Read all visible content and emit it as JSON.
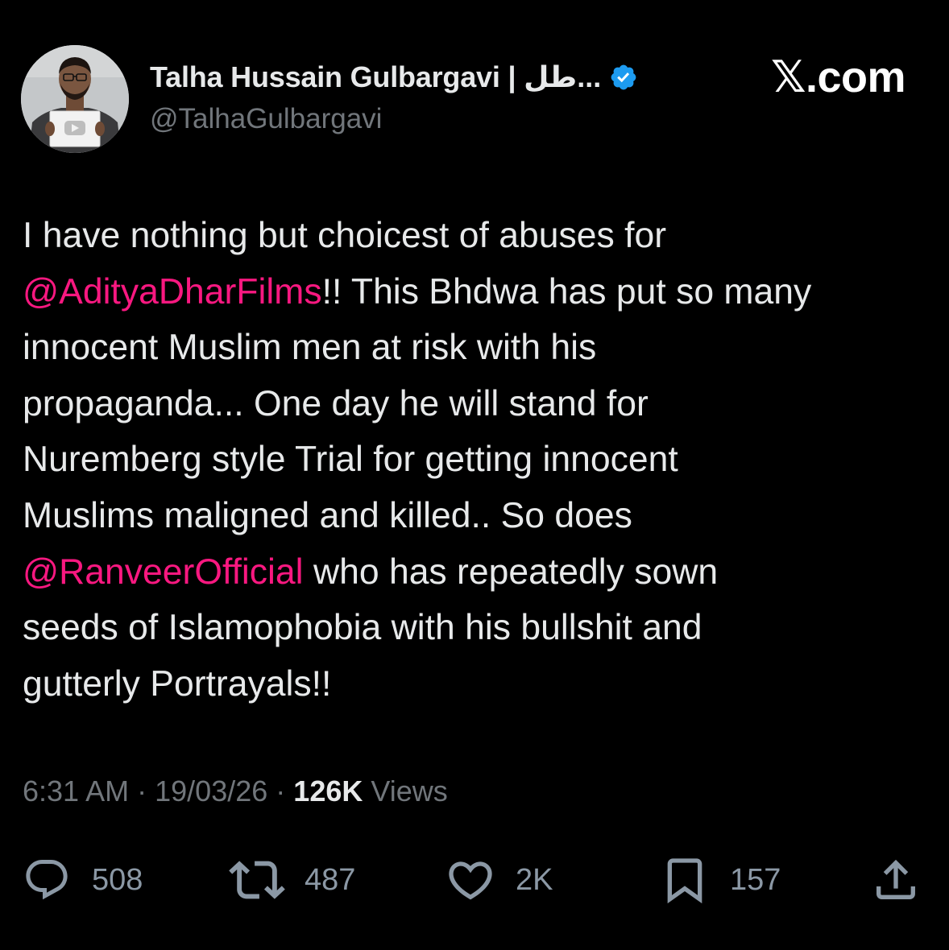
{
  "author": {
    "display_name": "Talha Hussain Gulbargavi | طل...",
    "handle": "@TalhaGulbargavi",
    "verified": true
  },
  "brand": "𝕏.com",
  "tweet": {
    "lines": [
      [
        {
          "text": "I have nothing but choicest of abuses for",
          "mention": false
        }
      ],
      [
        {
          "text": "@AdityaDharFilms",
          "mention": true
        },
        {
          "text": "!! This Bhdwa has put so many",
          "mention": false
        }
      ],
      [
        {
          "text": "innocent Muslim men at risk with his",
          "mention": false
        }
      ],
      [
        {
          "text": "propaganda... One day he will stand for",
          "mention": false
        }
      ],
      [
        {
          "text": "Nuremberg style Trial for getting innocent",
          "mention": false
        }
      ],
      [
        {
          "text": "Muslims maligned and killed.. So does",
          "mention": false
        }
      ],
      [
        {
          "text": "@RanveerOfficial",
          "mention": true
        },
        {
          "text": " who has repeatedly sown",
          "mention": false
        }
      ],
      [
        {
          "text": "seeds of Islamophobia with his bullshit and",
          "mention": false
        }
      ],
      [
        {
          "text": "gutterly Portrayals!!",
          "mention": false
        }
      ]
    ]
  },
  "meta": {
    "time": "6:31 AM",
    "separator": "·",
    "date": "19/03/26",
    "views_count": "126K",
    "views_label": "Views"
  },
  "actions": {
    "replies": "508",
    "reposts": "487",
    "likes": "2K",
    "bookmarks": "157"
  },
  "icons": {
    "reply": "reply-icon",
    "repost": "repost-icon",
    "like": "heart-icon",
    "bookmark": "bookmark-icon",
    "share": "share-icon",
    "verified": "verified-badge-icon"
  },
  "colors": {
    "background": "#000000",
    "text": "#e7e9ea",
    "secondary": "#71767b",
    "mention": "#f91880",
    "verified": "#1d9bf0"
  }
}
